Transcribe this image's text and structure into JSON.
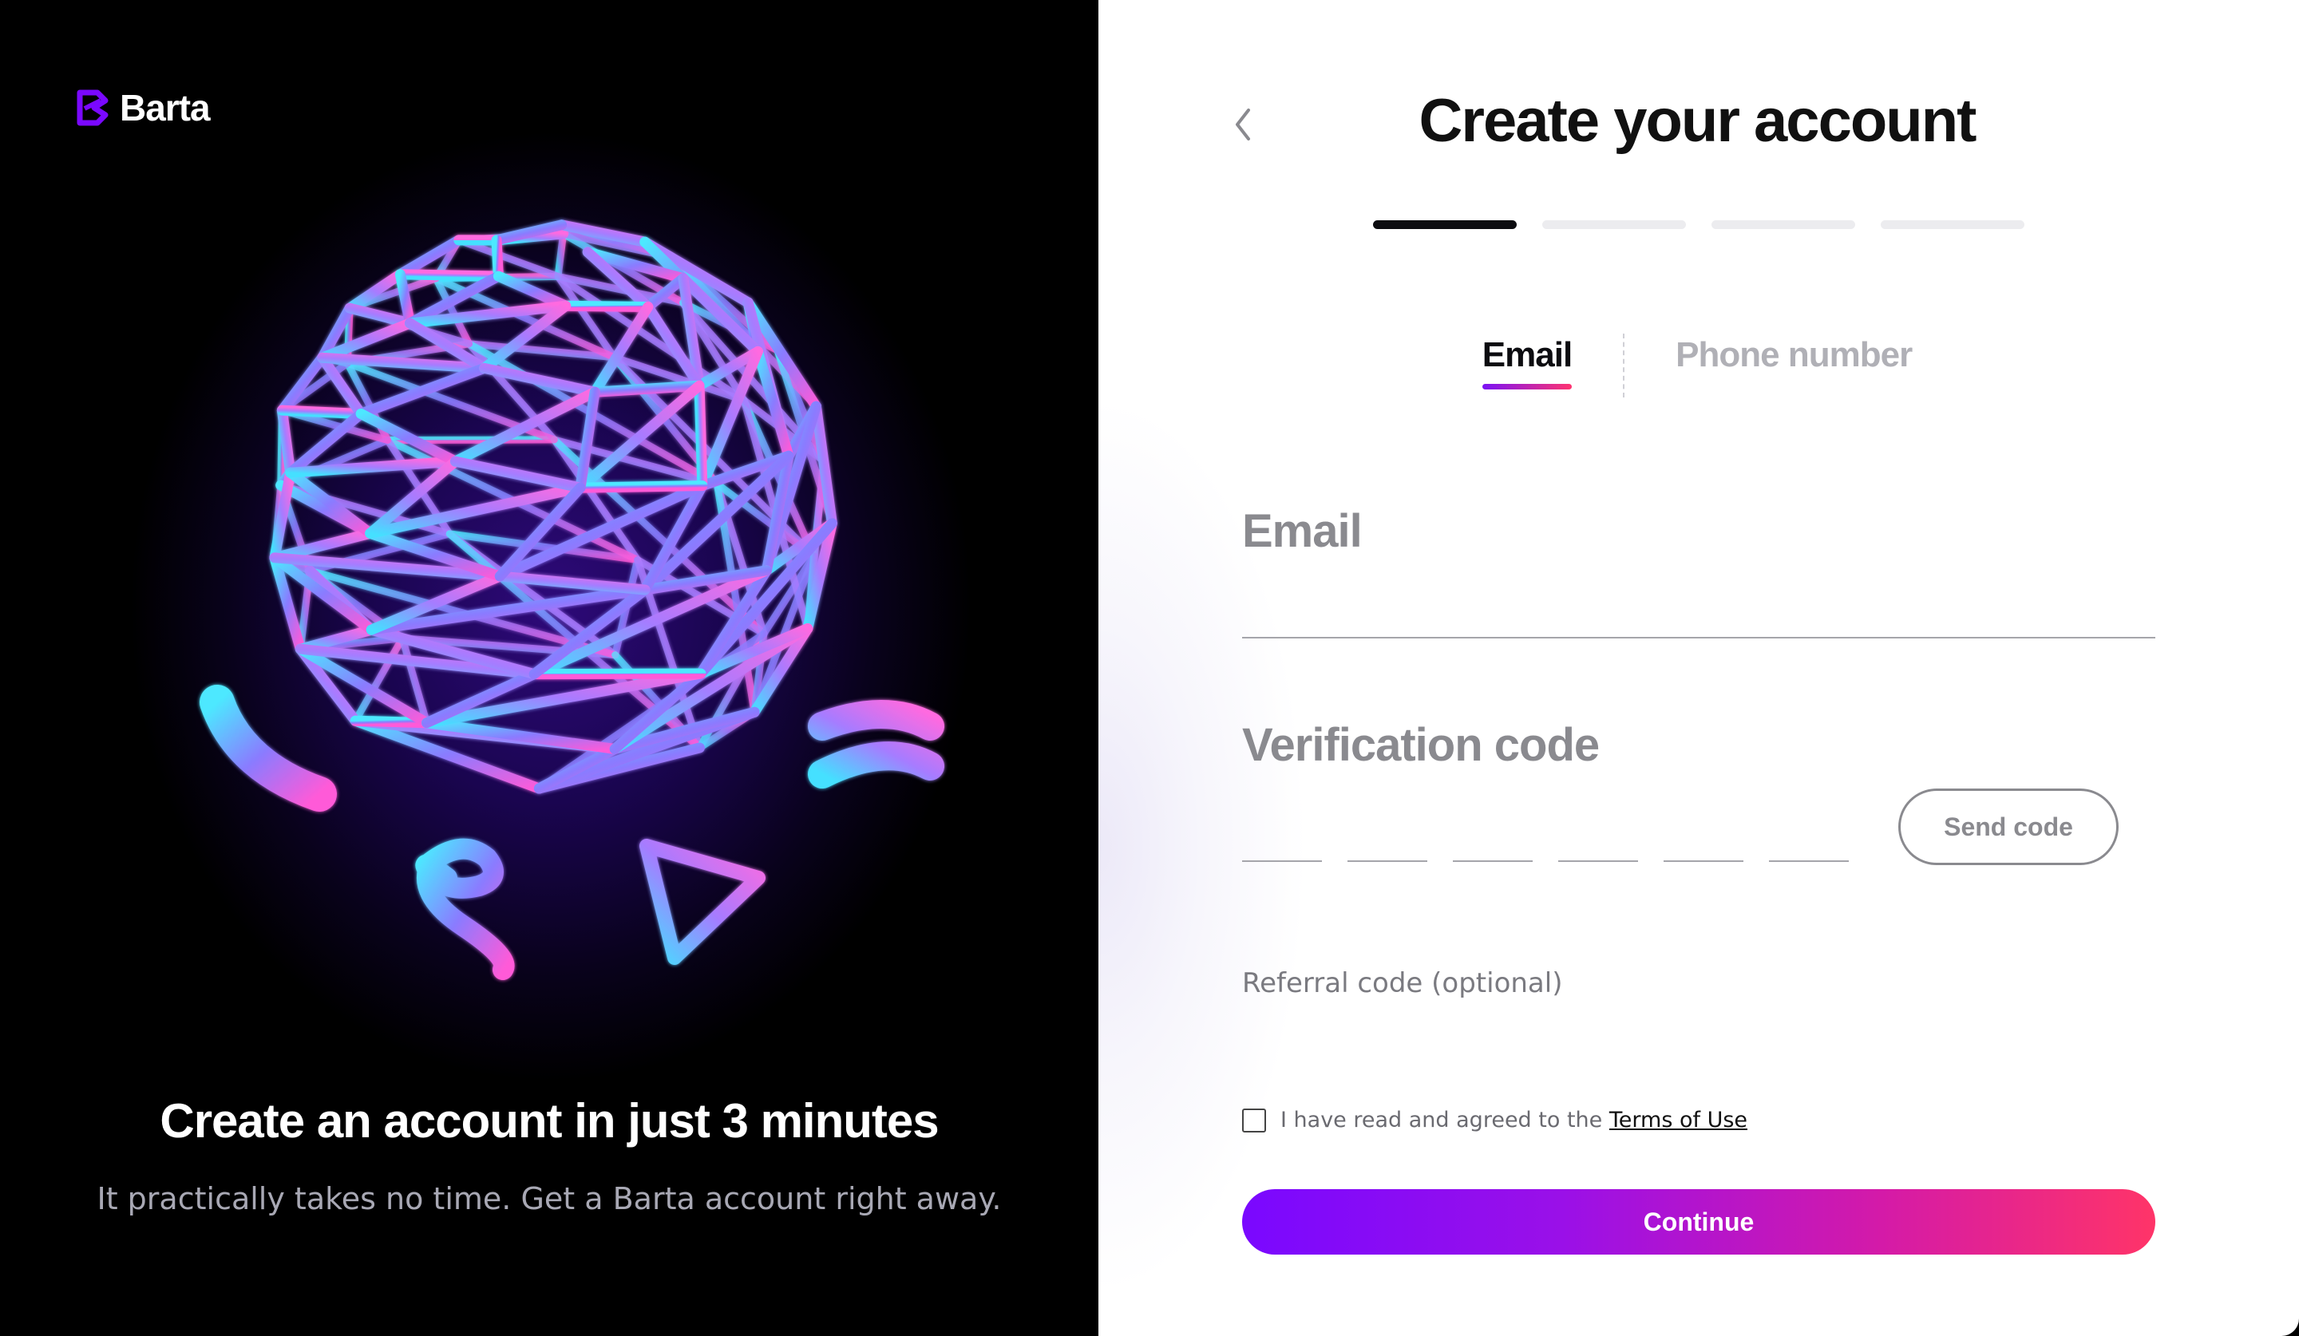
{
  "brand": {
    "name": "Barta",
    "accent_start": "#7a08ff",
    "accent_end": "#ff3468"
  },
  "promo": {
    "title": "Create an account in just 3 minutes",
    "subtitle": "It practically takes no time. Get a Barta account right away."
  },
  "form": {
    "back_icon": "chevron-left-icon",
    "title": "Create your account",
    "steps": {
      "total": 4,
      "current": 1
    },
    "tabs": [
      {
        "label": "Email",
        "active": true
      },
      {
        "label": "Phone number",
        "active": false
      }
    ],
    "email": {
      "label": "Email",
      "value": ""
    },
    "verification": {
      "label": "Verification code",
      "digits": 6,
      "send_label": "Send code"
    },
    "referral": {
      "label": "Referral code (optional)",
      "value": ""
    },
    "terms": {
      "text": "I have read and agreed to the",
      "link": "Terms of Use",
      "checked": false
    },
    "continue_label": "Continue"
  }
}
